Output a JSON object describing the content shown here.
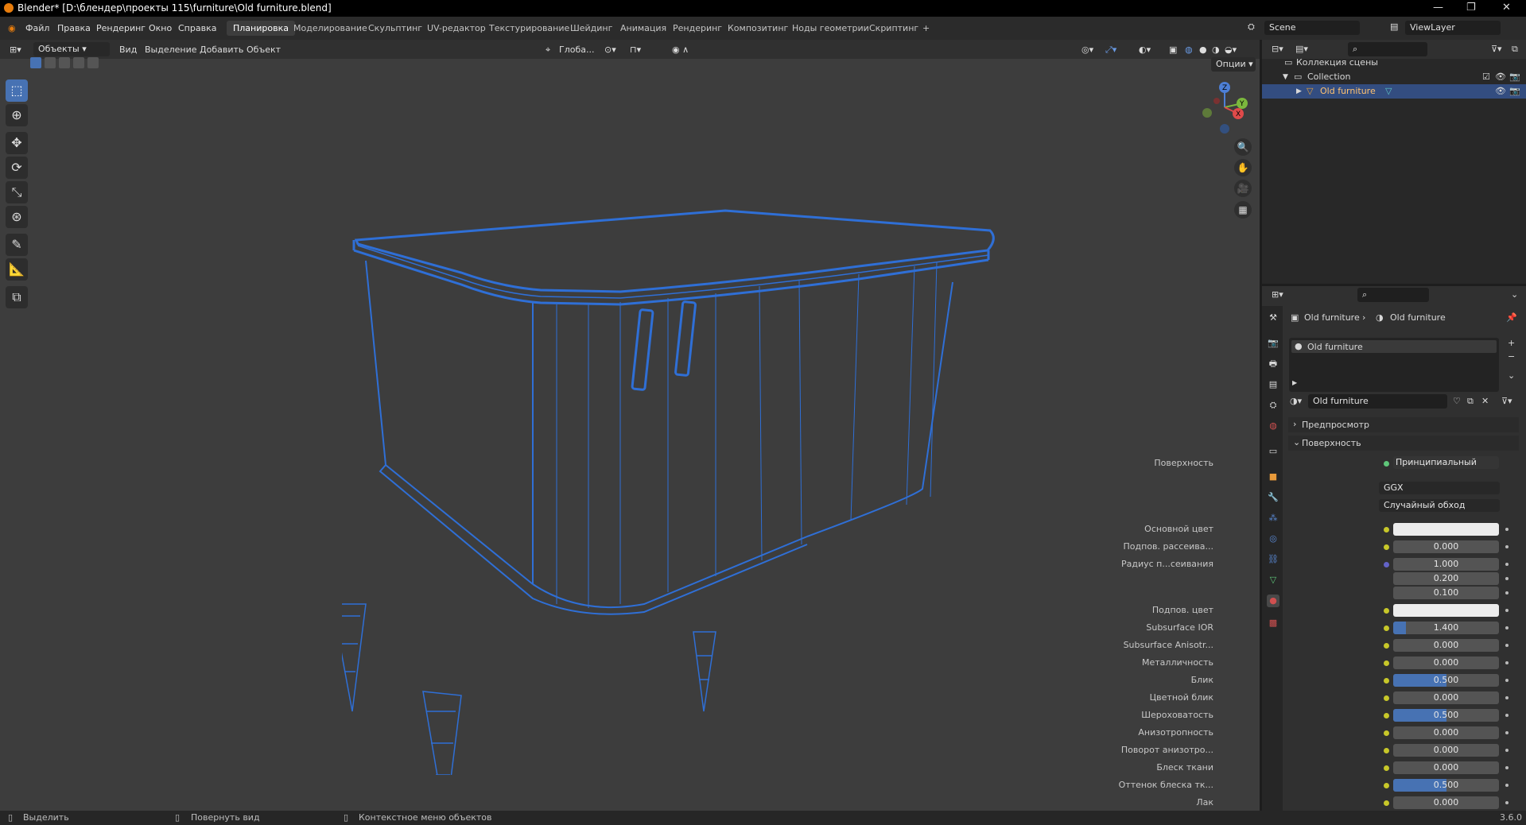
{
  "window": {
    "title": "Blender* [D:\\блендер\\проекты 115\\furniture\\Old furniture.blend]",
    "controls": [
      "—",
      "❐",
      "✕"
    ]
  },
  "menu": [
    "Файл",
    "Правка",
    "Рендеринг",
    "Окно",
    "Справка"
  ],
  "workspaces": [
    "Планировка",
    "Моделирование",
    "Скульптинг",
    "UV-редактор",
    "Текстурирование",
    "Шейдинг",
    "Анимация",
    "Рендеринг",
    "Композитинг",
    "Ноды геометрии",
    "Скриптинг",
    "+"
  ],
  "workspace_active": "Планировка",
  "scene": {
    "name": "Scene",
    "viewlayer": "ViewLayer"
  },
  "viewport_header": {
    "mode": "Объекты",
    "menus": [
      "Вид",
      "Выделение",
      "Добавить",
      "Объект"
    ],
    "orientation": "Глоба...",
    "options": "Опции"
  },
  "outliner": {
    "root": "Коллекция сцены",
    "collection": "Collection",
    "object": "Old furniture"
  },
  "properties": {
    "breadcrumb_object": "Old furniture",
    "breadcrumb_material": "Old furniture",
    "slot": "Old furniture",
    "material_name": "Old furniture",
    "panel_preview": "Предпросмотр",
    "panel_surface": "Поверхность",
    "surface_label": "Поверхность",
    "surface_value": "Принципиальный BSDF",
    "distribution": "GGX",
    "subsurface_method": "Случайный обход",
    "rows": [
      {
        "label": "Основной цвет",
        "value": "",
        "kind": "color",
        "color": "#ececec"
      },
      {
        "label": "Подпов. рассеива...",
        "value": "0.000",
        "kind": "num",
        "fill": 0
      },
      {
        "label": "Радиус п...сеивания",
        "value": "1.000",
        "kind": "num",
        "fill": 0
      },
      {
        "label": "",
        "value": "0.200",
        "kind": "num",
        "fill": 0
      },
      {
        "label": "",
        "value": "0.100",
        "kind": "num",
        "fill": 0
      },
      {
        "label": "Подпов. цвет",
        "value": "",
        "kind": "color",
        "color": "#ececec"
      },
      {
        "label": "Subsurface IOR",
        "value": "1.400",
        "kind": "num",
        "fill": 0.12
      },
      {
        "label": "Subsurface Anisotr...",
        "value": "0.000",
        "kind": "num",
        "fill": 0
      },
      {
        "label": "Металличность",
        "value": "0.000",
        "kind": "num",
        "fill": 0
      },
      {
        "label": "Блик",
        "value": "0.500",
        "kind": "num",
        "fill": 0.5
      },
      {
        "label": "Цветной блик",
        "value": "0.000",
        "kind": "num",
        "fill": 0
      },
      {
        "label": "Шероховатость",
        "value": "0.500",
        "kind": "num",
        "fill": 0.5
      },
      {
        "label": "Анизотропность",
        "value": "0.000",
        "kind": "num",
        "fill": 0
      },
      {
        "label": "Поворот анизотро...",
        "value": "0.000",
        "kind": "num",
        "fill": 0
      },
      {
        "label": "Блеск ткани",
        "value": "0.000",
        "kind": "num",
        "fill": 0
      },
      {
        "label": "Оттенок блеска тк...",
        "value": "0.500",
        "kind": "num",
        "fill": 0.5
      },
      {
        "label": "Лак",
        "value": "0.000",
        "kind": "num",
        "fill": 0
      }
    ]
  },
  "status": {
    "select": "Выделить",
    "rotate": "Повернуть вид",
    "context": "Контекстное меню объектов",
    "version": "3.6.0"
  },
  "colors": {
    "accent": "#4772b3",
    "wire": "#2f6fd6",
    "brand": "#e87d0d"
  }
}
